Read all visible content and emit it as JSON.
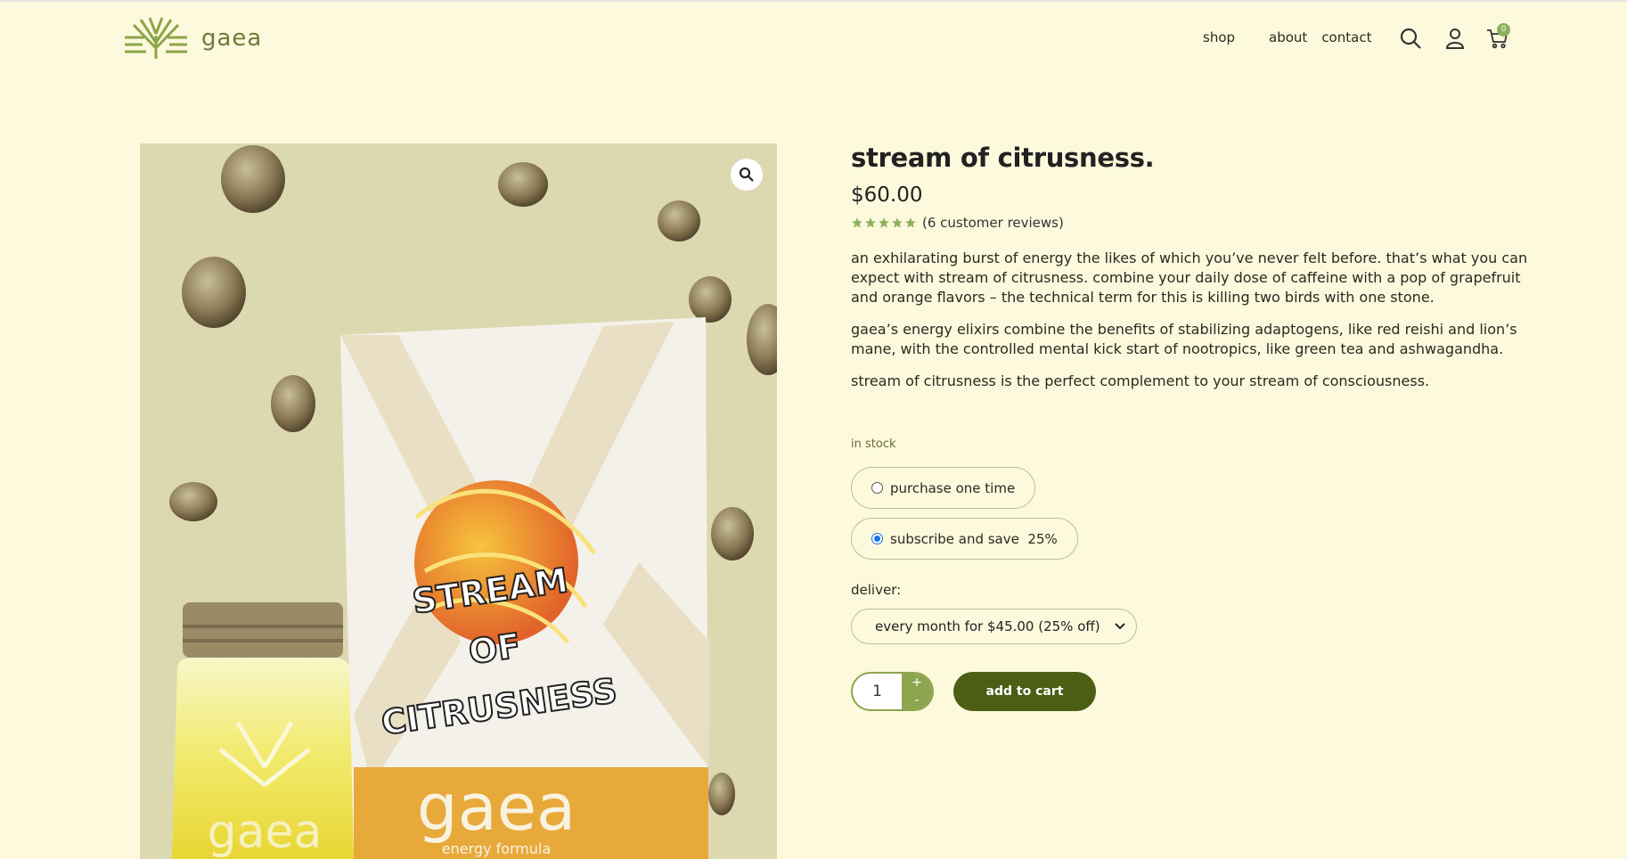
{
  "brand": {
    "name": "gaea"
  },
  "nav": {
    "items": [
      "shop",
      "about",
      "contact"
    ]
  },
  "header_icons": [
    "search-icon",
    "user-icon",
    "cart-icon"
  ],
  "cart": {
    "count": "0"
  },
  "product": {
    "title": "stream of citrusness.",
    "price": "$60.00",
    "rating": 5,
    "reviews_label": "(6 customer reviews)",
    "description": [
      "an exhilarating burst of energy the likes of which you’ve never felt before. that’s what you can expect with stream of citrusness. combine your daily dose of caffeine with a pop of grapefruit and orange flavors – the technical term for this is killing two birds with one stone.",
      "gaea’s energy elixirs combine the benefits of stabilizing adaptogens, like red reishi and lion’s mane, with the controlled mental kick start of nootropics, like green tea and ashwagandha.",
      "stream of citrusness is the perfect complement to your stream of consciousness."
    ],
    "stock": "in stock",
    "purchase_options": [
      {
        "label": "purchase one time",
        "selected": false
      },
      {
        "label": "subscribe and save  25%",
        "selected": true
      }
    ],
    "deliver_label": "deliver:",
    "deliver_selected": "every month for $45.00 (25% off)",
    "quantity": "1",
    "qty_plus": "+",
    "qty_minus": "-",
    "add_to_cart_label": "add to cart"
  },
  "image": {
    "pouch_text": [
      "STREAM",
      "OF",
      "CITRUSNESS"
    ],
    "pouch_brand": "gaea",
    "pouch_subtitle": "energy formula",
    "jar_brand": "gaea"
  },
  "colors": {
    "background": "#fdf9dc",
    "accent": "#8da54e",
    "button": "#4b5e13",
    "image_bg": "#dcd9b0",
    "star": "#8db05a"
  }
}
